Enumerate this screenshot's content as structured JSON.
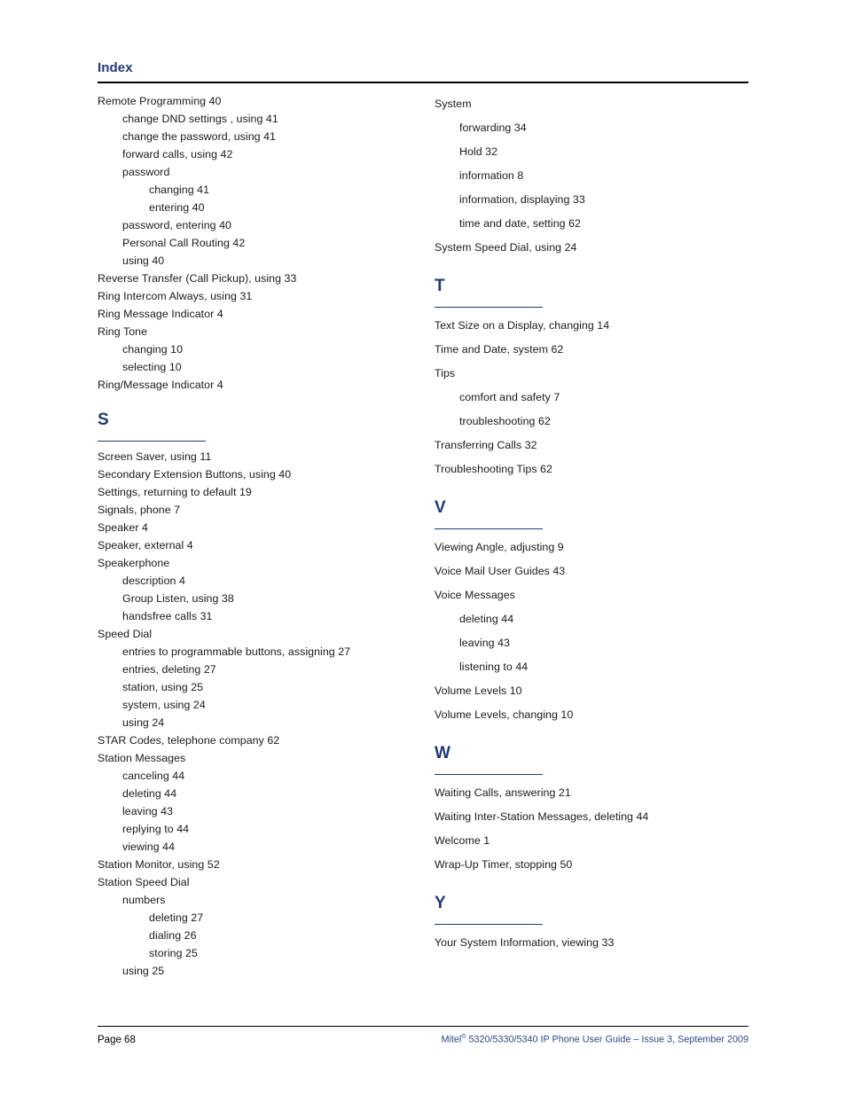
{
  "header": {
    "title": "Index"
  },
  "columns": {
    "left": [
      {
        "kind": "entry",
        "level": 0,
        "text": "Remote Programming  40"
      },
      {
        "kind": "entry",
        "level": 1,
        "text": "change DND settings , using  41"
      },
      {
        "kind": "entry",
        "level": 1,
        "text": "change the password, using  41"
      },
      {
        "kind": "entry",
        "level": 1,
        "text": "forward calls, using  42"
      },
      {
        "kind": "entry",
        "level": 1,
        "text": "password"
      },
      {
        "kind": "entry",
        "level": 2,
        "text": "changing  41"
      },
      {
        "kind": "entry",
        "level": 2,
        "text": "entering  40"
      },
      {
        "kind": "entry",
        "level": 1,
        "text": "password, entering  40"
      },
      {
        "kind": "entry",
        "level": 1,
        "text": "Personal Call Routing  42"
      },
      {
        "kind": "entry",
        "level": 1,
        "text": "using  40"
      },
      {
        "kind": "entry",
        "level": 0,
        "text": "Reverse Transfer (Call Pickup), using  33"
      },
      {
        "kind": "entry",
        "level": 0,
        "text": "Ring Intercom Always, using  31"
      },
      {
        "kind": "entry",
        "level": 0,
        "text": "Ring Message Indicator  4"
      },
      {
        "kind": "entry",
        "level": 0,
        "text": "Ring Tone"
      },
      {
        "kind": "entry",
        "level": 1,
        "text": "changing  10"
      },
      {
        "kind": "entry",
        "level": 1,
        "text": "selecting  10"
      },
      {
        "kind": "entry",
        "level": 0,
        "text": "Ring/Message Indicator  4"
      },
      {
        "kind": "letter",
        "text": "S"
      },
      {
        "kind": "entry",
        "level": 0,
        "text": "Screen Saver, using  11"
      },
      {
        "kind": "entry",
        "level": 0,
        "text": "Secondary Extension Buttons, using  40"
      },
      {
        "kind": "entry",
        "level": 0,
        "text": "Settings, returning to default  19"
      },
      {
        "kind": "entry",
        "level": 0,
        "text": "Signals, phone  7"
      },
      {
        "kind": "entry",
        "level": 0,
        "text": "Speaker  4"
      },
      {
        "kind": "entry",
        "level": 0,
        "text": "Speaker, external  4"
      },
      {
        "kind": "entry",
        "level": 0,
        "text": "Speakerphone"
      },
      {
        "kind": "entry",
        "level": 1,
        "text": "description  4"
      },
      {
        "kind": "entry",
        "level": 1,
        "text": "Group Listen, using  38"
      },
      {
        "kind": "entry",
        "level": 1,
        "text": "handsfree calls  31"
      },
      {
        "kind": "entry",
        "level": 0,
        "text": "Speed Dial"
      },
      {
        "kind": "entry",
        "level": 1,
        "text": "entries to programmable buttons, assigning  27"
      },
      {
        "kind": "entry",
        "level": 1,
        "text": "entries, deleting  27"
      },
      {
        "kind": "entry",
        "level": 1,
        "text": "station, using  25"
      },
      {
        "kind": "entry",
        "level": 1,
        "text": "system, using  24"
      },
      {
        "kind": "entry",
        "level": 1,
        "text": "using  24"
      },
      {
        "kind": "entry",
        "level": 0,
        "text": "STAR Codes, telephone company  62"
      },
      {
        "kind": "entry",
        "level": 0,
        "text": "Station Messages"
      },
      {
        "kind": "entry",
        "level": 1,
        "text": "canceling  44"
      },
      {
        "kind": "entry",
        "level": 1,
        "text": "deleting  44"
      },
      {
        "kind": "entry",
        "level": 1,
        "text": "leaving  43"
      },
      {
        "kind": "entry",
        "level": 1,
        "text": "replying to  44"
      },
      {
        "kind": "entry",
        "level": 1,
        "text": "viewing  44"
      },
      {
        "kind": "entry",
        "level": 0,
        "text": "Station Monitor, using  52"
      },
      {
        "kind": "entry",
        "level": 0,
        "text": "Station Speed Dial"
      },
      {
        "kind": "entry",
        "level": 1,
        "text": "numbers"
      },
      {
        "kind": "entry",
        "level": 2,
        "text": "deleting  27"
      },
      {
        "kind": "entry",
        "level": 2,
        "text": "dialing  26"
      },
      {
        "kind": "entry",
        "level": 2,
        "text": "storing  25"
      },
      {
        "kind": "entry",
        "level": 1,
        "text": "using  25"
      }
    ],
    "right": [
      {
        "kind": "entry",
        "level": 0,
        "text": "System"
      },
      {
        "kind": "entry",
        "level": 1,
        "text": "forwarding  34"
      },
      {
        "kind": "entry",
        "level": 1,
        "text": "Hold  32"
      },
      {
        "kind": "entry",
        "level": 1,
        "text": "information  8"
      },
      {
        "kind": "entry",
        "level": 1,
        "text": "information, displaying  33"
      },
      {
        "kind": "entry",
        "level": 1,
        "text": "time and date, setting  62"
      },
      {
        "kind": "entry",
        "level": 0,
        "text": "System Speed Dial, using  24"
      },
      {
        "kind": "letter",
        "text": "T"
      },
      {
        "kind": "entry",
        "level": 0,
        "text": "Text Size on a Display, changing  14"
      },
      {
        "kind": "entry",
        "level": 0,
        "text": "Time and Date, system  62"
      },
      {
        "kind": "entry",
        "level": 0,
        "text": "Tips"
      },
      {
        "kind": "entry",
        "level": 1,
        "text": "comfort and safety  7"
      },
      {
        "kind": "entry",
        "level": 1,
        "text": "troubleshooting  62"
      },
      {
        "kind": "entry",
        "level": 0,
        "text": "Transferring Calls  32"
      },
      {
        "kind": "entry",
        "level": 0,
        "text": "Troubleshooting Tips  62"
      },
      {
        "kind": "letter",
        "text": "V"
      },
      {
        "kind": "entry",
        "level": 0,
        "text": "Viewing Angle, adjusting  9"
      },
      {
        "kind": "entry",
        "level": 0,
        "text": "Voice Mail User Guides  43"
      },
      {
        "kind": "entry",
        "level": 0,
        "text": "Voice Messages"
      },
      {
        "kind": "entry",
        "level": 1,
        "text": "deleting  44"
      },
      {
        "kind": "entry",
        "level": 1,
        "text": "leaving  43"
      },
      {
        "kind": "entry",
        "level": 1,
        "text": "listening to  44"
      },
      {
        "kind": "entry",
        "level": 0,
        "text": "Volume Levels  10"
      },
      {
        "kind": "entry",
        "level": 0,
        "text": "Volume Levels, changing  10"
      },
      {
        "kind": "letter",
        "text": "W"
      },
      {
        "kind": "entry",
        "level": 0,
        "text": "Waiting Calls, answering  21"
      },
      {
        "kind": "entry",
        "level": 0,
        "text": "Waiting Inter-Station Messages, deleting  44"
      },
      {
        "kind": "entry",
        "level": 0,
        "text": "Welcome  1"
      },
      {
        "kind": "entry",
        "level": 0,
        "text": "Wrap-Up Timer, stopping  50"
      },
      {
        "kind": "letter",
        "text": "Y"
      },
      {
        "kind": "entry",
        "level": 0,
        "text": "Your System Information, viewing  33"
      }
    ]
  },
  "footer": {
    "page_label": "Page 68",
    "guide_brand": "Mitel",
    "guide_registered_mark": "®",
    "guide_text": " 5320/5330/5340 IP Phone User Guide  – Issue 3, September 2009"
  },
  "colors": {
    "heading_blue": "#1f3a7a",
    "footer_blue": "#2b4a8b",
    "rule_black": "#000000",
    "body_text": "#1a1a1a"
  }
}
